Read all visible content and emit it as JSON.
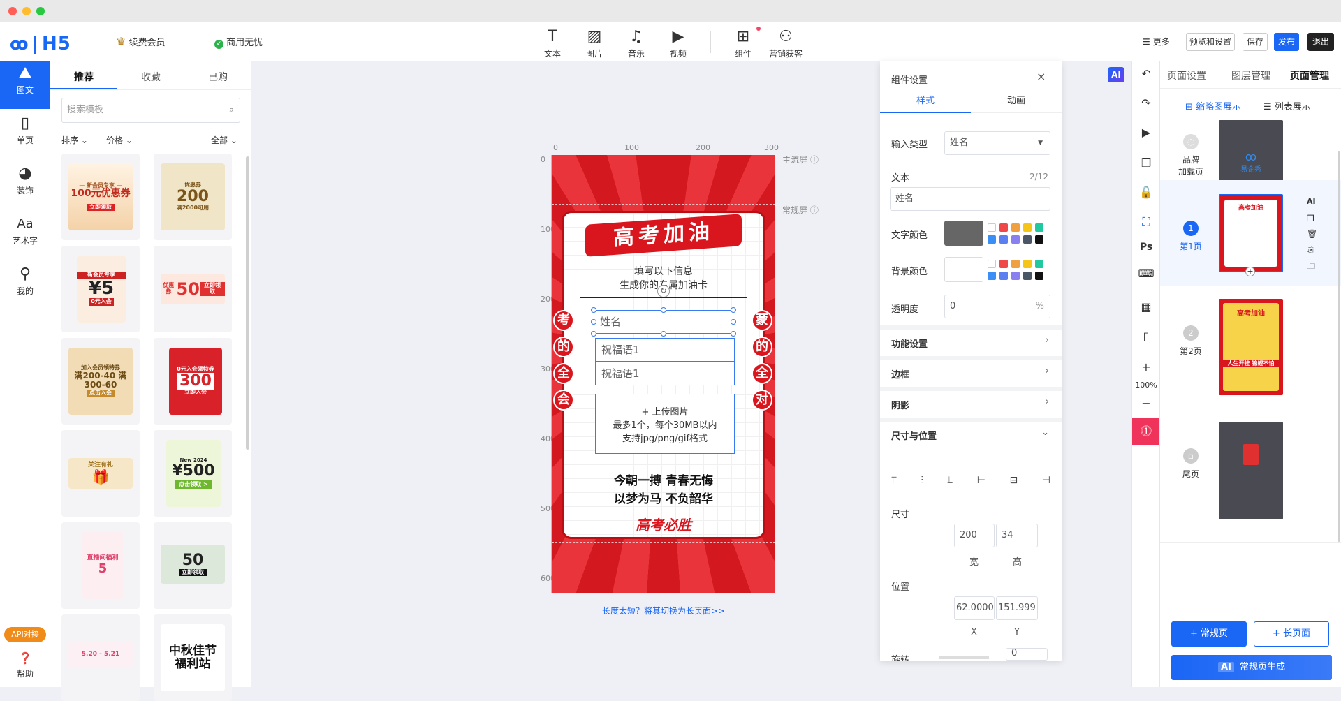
{
  "brand": {
    "logo": "H5",
    "member": "续费会员",
    "commercial": "商用无忧"
  },
  "toolbar": {
    "items": [
      "文本",
      "图片",
      "音乐",
      "视频",
      "组件",
      "营销获客"
    ],
    "more": "更多",
    "preview": "预览和设置",
    "save": "保存",
    "publish": "发布",
    "exit": "退出"
  },
  "leftnav": {
    "items": [
      "图文",
      "单页",
      "装饰",
      "艺术字",
      "我的"
    ],
    "api": "API对接",
    "help": "帮助"
  },
  "templates": {
    "tabs": [
      "推荐",
      "收藏",
      "已购"
    ],
    "search_placeholder": "搜索模板",
    "filters": [
      "排序",
      "价格",
      "全部"
    ],
    "cards": [
      {
        "t1": "— 新会员专享 —",
        "t2": "100元优惠券",
        "t3": "立即领取"
      },
      {
        "t1": "优惠券",
        "t2": "200",
        "t3": "满2000可用"
      },
      {
        "t1": "新会员专享",
        "t2": "¥5",
        "t3": "0元入会"
      },
      {
        "t1": "优惠券",
        "t2": "50",
        "t3": "立即领取"
      },
      {
        "t1": "加入会员领特券",
        "t2": "满200-40 满300-60",
        "t3": "点击入会"
      },
      {
        "t1": "0元入会领特券",
        "t2": "300",
        "t3": "立即入会"
      },
      {
        "t1": "关注有礼",
        "t2": "",
        "t3": ""
      },
      {
        "t1": "New 2024",
        "t2": "¥500",
        "t3": "点击领取"
      },
      {
        "t1": "直播间福利",
        "t2": "5",
        "t3": ""
      },
      {
        "t1": "50",
        "t2": "",
        "t3": "立即领取"
      },
      {
        "t1": "5.20 - 5.21",
        "t2": "",
        "t3": ""
      },
      {
        "t1": "中秋佳节",
        "t2": "福利站",
        "t3": ""
      }
    ]
  },
  "canvas": {
    "ruler_top": [
      "0",
      "100",
      "200",
      "300"
    ],
    "ruler_left": [
      "0",
      "100",
      "200",
      "300",
      "400",
      "500",
      "600"
    ],
    "main_screen": "主流屏",
    "normal_screen": "常规屏",
    "title": "高考加油",
    "prompt1": "填写以下信息",
    "prompt2": "生成你的专属加油卡",
    "left_chars": [
      "考",
      "的",
      "全",
      "会"
    ],
    "right_chars": [
      "蒙",
      "的",
      "全",
      "对"
    ],
    "field_name": "姓名",
    "field_wish1": "祝福语1",
    "field_wish2": "祝福语1",
    "upload1": "+ 上传图片",
    "upload2": "最多1个，每个30MB以内",
    "upload3": "支持jpg/png/gif格式",
    "slogan1": "今朝一搏 青春无悔",
    "slogan2": "以梦为马 不负韶华",
    "signature": "高考必胜",
    "switch_hint": "长度太短？将其切换为长页面>>"
  },
  "settings": {
    "title": "组件设置",
    "tabs": [
      "样式",
      "动画"
    ],
    "input_type_label": "输入类型",
    "input_type_value": "姓名",
    "text_label": "文本",
    "text_count": "2/12",
    "text_value": "姓名",
    "text_color_label": "文字颜色",
    "bg_color_label": "背景颜色",
    "opacity_label": "透明度",
    "opacity_value": "0",
    "opacity_unit": "%",
    "sections": [
      "功能设置",
      "边框",
      "阴影",
      "尺寸与位置"
    ],
    "size_label": "尺寸",
    "width": "200",
    "height": "34",
    "w_label": "宽",
    "h_label": "高",
    "position_label": "位置",
    "x": "62.0000",
    "y": "151.999",
    "x_label": "X",
    "y_label": "Y",
    "rotate_label": "旋转",
    "rotate_value": "0",
    "text_color": "#666666",
    "palette": [
      "#ffffff",
      "#f04848",
      "#f0a040",
      "#f5c518",
      "#20c9a0",
      "#3a8ef5",
      "#5b7ff0",
      "#8a7ff0",
      "#4a5566",
      "#111111"
    ]
  },
  "ai_badge": "AI",
  "righttools": {
    "zoom": "100%",
    "plus": "+",
    "minus": "−"
  },
  "pages": {
    "tabs": [
      "页面设置",
      "图层管理",
      "页面管理"
    ],
    "view_thumb": "缩略图展示",
    "view_list": "列表展示",
    "items": [
      {
        "num": "",
        "label": "品牌\n加载页"
      },
      {
        "num": "1",
        "label": "第1页"
      },
      {
        "num": "2",
        "label": "第2页"
      },
      {
        "num": "",
        "label": "尾页"
      }
    ],
    "add_normal": "+ 常规页",
    "add_long": "+ 长页面",
    "ai_gen": "常规页生成",
    "ai_tag": "AI",
    "loading_text": "易企秀",
    "page2_banner": "人生开挂 锦鲤不怕"
  }
}
